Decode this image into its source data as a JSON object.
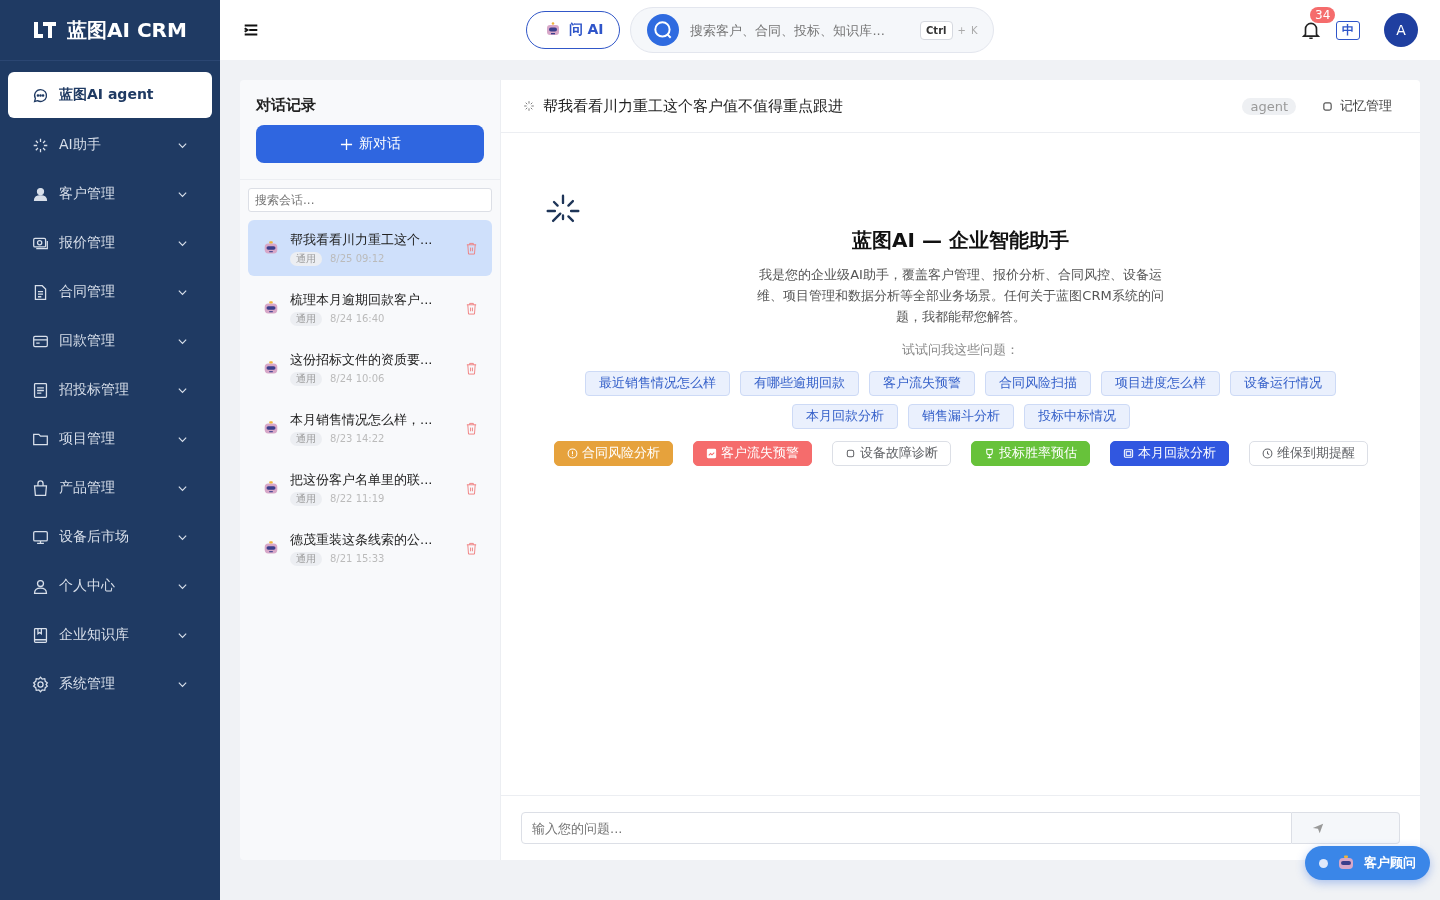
{
  "brand": {
    "name": "蓝图AI CRM"
  },
  "sidebar": {
    "items": [
      {
        "label": "蓝图AI agent",
        "selected": true,
        "expandable": false
      },
      {
        "label": "AI助手",
        "selected": false,
        "expandable": true
      },
      {
        "label": "客户管理",
        "selected": false,
        "expandable": true
      },
      {
        "label": "报价管理",
        "selected": false,
        "expandable": true
      },
      {
        "label": "合同管理",
        "selected": false,
        "expandable": true
      },
      {
        "label": "回款管理",
        "selected": false,
        "expandable": true
      },
      {
        "label": "招投标管理",
        "selected": false,
        "expandable": true
      },
      {
        "label": "项目管理",
        "selected": false,
        "expandable": true
      },
      {
        "label": "产品管理",
        "selected": false,
        "expandable": true
      },
      {
        "label": "设备后市场",
        "selected": false,
        "expandable": true
      },
      {
        "label": "个人中心",
        "selected": false,
        "expandable": true
      },
      {
        "label": "企业知识库",
        "selected": false,
        "expandable": true
      },
      {
        "label": "系统管理",
        "selected": false,
        "expandable": true
      }
    ]
  },
  "header": {
    "ask_ai": "问 AI",
    "search": {
      "placeholder": "搜索客户、合同、投标、知识库...",
      "keys": [
        "Ctrl",
        "+",
        "K"
      ]
    },
    "notifications": "34",
    "language": "中",
    "avatar": "A"
  },
  "history": {
    "title": "对话记录",
    "new_button": "新对话",
    "search": {
      "placeholder": "搜索会话..."
    },
    "items": [
      {
        "title": "帮我看看川力重工这个...",
        "tag": "通用",
        "time": "8/25 09:12",
        "selected": true
      },
      {
        "title": "梳理本月逾期回款客户...",
        "tag": "通用",
        "time": "8/24 16:40",
        "selected": false
      },
      {
        "title": "这份招标文件的资质要...",
        "tag": "通用",
        "time": "8/24 10:06",
        "selected": false
      },
      {
        "title": "本月销售情况怎么样，...",
        "tag": "通用",
        "time": "8/23 14:22",
        "selected": false
      },
      {
        "title": "把这份客户名单里的联...",
        "tag": "通用",
        "time": "8/22 11:19",
        "selected": false
      },
      {
        "title": "德茂重装这条线索的公...",
        "tag": "通用",
        "time": "8/21 15:33",
        "selected": false
      }
    ]
  },
  "chat": {
    "title": "帮我看看川力重工这个客户值不值得重点跟进",
    "mode_tag": "agent",
    "memory_button": "记忆管理",
    "welcome": {
      "heading": "蓝图AI — 企业智能助手",
      "intro": "我是您的企业级AI助手，覆盖客户管理、报价分析、合同风控、设备运维、项目管理和数据分析等全部业务场景。任何关于蓝图CRM系统的问题，我都能帮您解答。",
      "prompt_label": "试试问我这些问题："
    },
    "suggestions": [
      "最近销售情况怎么样",
      "有哪些逾期回款",
      "客户流失预警",
      "合同风险扫描",
      "项目进度怎么样",
      "设备运行情况",
      "本月回款分析",
      "销售漏斗分析",
      "投标中标情况"
    ],
    "actions": [
      {
        "label": "合同风险分析",
        "kind": "filled",
        "color": "#e6a23c"
      },
      {
        "label": "客户流失预警",
        "kind": "filled",
        "color": "#f56c6c"
      },
      {
        "label": "设备故障诊断",
        "kind": "outline",
        "color": "#606266"
      },
      {
        "label": "投标胜率预估",
        "kind": "filled",
        "color": "#67c23a"
      },
      {
        "label": "本月回款分析",
        "kind": "filled",
        "color": "#3157e0"
      },
      {
        "label": "维保到期提醒",
        "kind": "outline",
        "color": "#606266"
      }
    ],
    "input": {
      "placeholder": "输入您的问题..."
    }
  },
  "floating_button": {
    "label": "客户顾问"
  }
}
